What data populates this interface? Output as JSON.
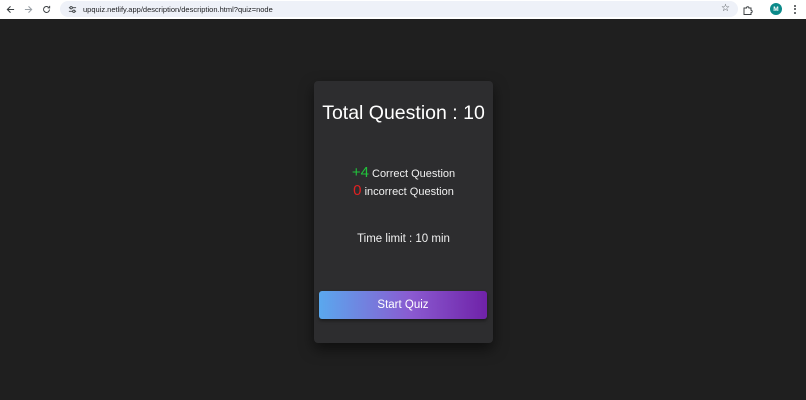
{
  "browser": {
    "url": "upquiz.netlify.app/description/description.html?quiz=node",
    "avatar_initial": "M",
    "back_icon": "arrow-left-icon",
    "forward_icon": "arrow-right-icon",
    "reload_icon": "reload-icon",
    "site_info_icon": "tune-icon",
    "bookmark_icon": "star-icon",
    "extensions_icon": "puzzle-icon",
    "menu_icon": "kebab-menu-icon"
  },
  "quiz": {
    "title": "Total Question : 10",
    "correct_value": "+4",
    "correct_label": "Correct Question",
    "incorrect_value": "0",
    "incorrect_label": "incorrect Question",
    "time_limit": "Time limit : 10 min",
    "start_label": "Start Quiz"
  },
  "colors": {
    "page_bg": "#1f1f1f",
    "card_bg": "#2d2d2f",
    "correct": "#21c23b",
    "incorrect": "#e02121",
    "button_gradient_start": "#5aa8ee",
    "button_gradient_end": "#6f22a8"
  }
}
